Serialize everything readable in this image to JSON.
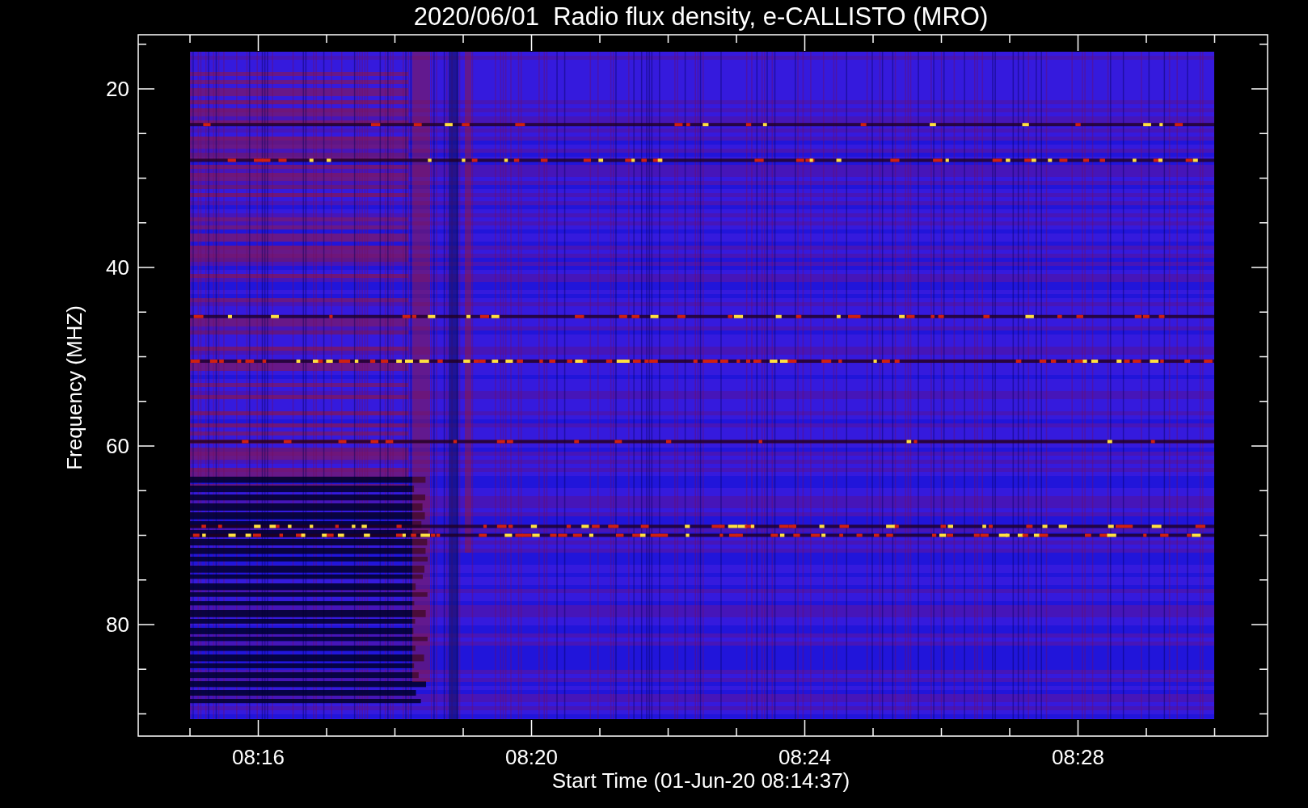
{
  "title": "2020/06/01  Radio flux density, e-CALLISTO (MRO)",
  "y_axis": {
    "label": "Frequency (MHZ)",
    "ticks": [
      "20",
      "40",
      "60",
      "80"
    ]
  },
  "x_axis": {
    "label": "Start Time (01-Jun-20 08:14:37)",
    "ticks": [
      "08:16",
      "08:20",
      "08:24",
      "08:28"
    ]
  }
}
